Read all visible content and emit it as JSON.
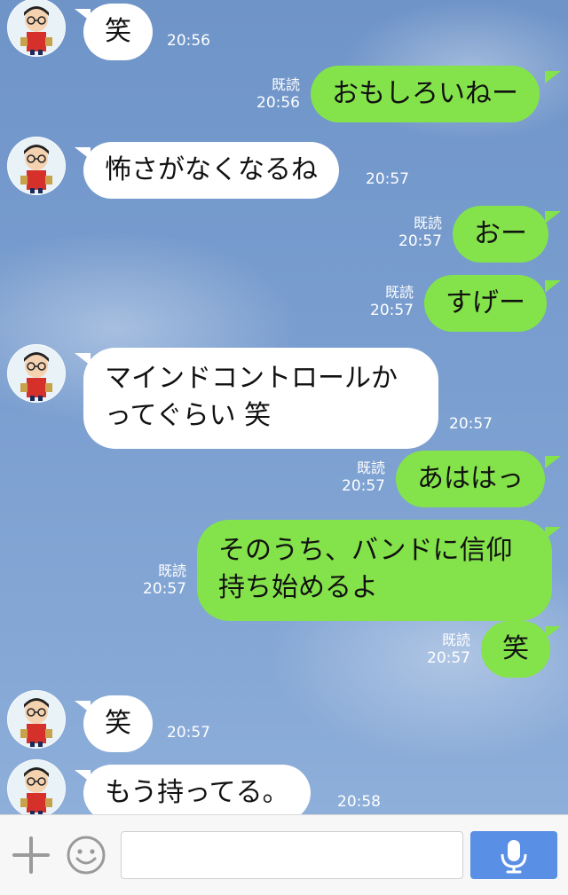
{
  "messages": [
    {
      "side": "in",
      "text": "笑",
      "time": "20:56"
    },
    {
      "side": "out",
      "text": "おもしろいねー",
      "read": "既読",
      "time": "20:56"
    },
    {
      "side": "in",
      "text": "怖さがなくなるね",
      "time": "20:57"
    },
    {
      "side": "out",
      "text": "おー",
      "read": "既読",
      "time": "20:57"
    },
    {
      "side": "out",
      "text": "すげー",
      "read": "既読",
      "time": "20:57"
    },
    {
      "side": "in",
      "text": "マインドコントロールか\nってぐらい 笑",
      "time": "20:57"
    },
    {
      "side": "out",
      "text": "あははっ",
      "read": "既読",
      "time": "20:57"
    },
    {
      "side": "out",
      "text": "そのうち、バンドに信仰\n持ち始めるよ",
      "read": "既読",
      "time": "20:57"
    },
    {
      "side": "out",
      "text": "笑",
      "read": "既読",
      "time": "20:57"
    },
    {
      "side": "in",
      "text": "笑",
      "time": "20:57"
    },
    {
      "side": "in",
      "text": "もう持ってる。",
      "time": "20:58"
    }
  ],
  "input": {
    "placeholder": "",
    "value": ""
  },
  "icons": {
    "add": "plus-icon",
    "emoji": "smiley-icon",
    "voice": "microphone-icon"
  },
  "colors": {
    "out_bubble": "#84e34a",
    "in_bubble": "#ffffff",
    "mic_button": "#5a8fe6"
  }
}
